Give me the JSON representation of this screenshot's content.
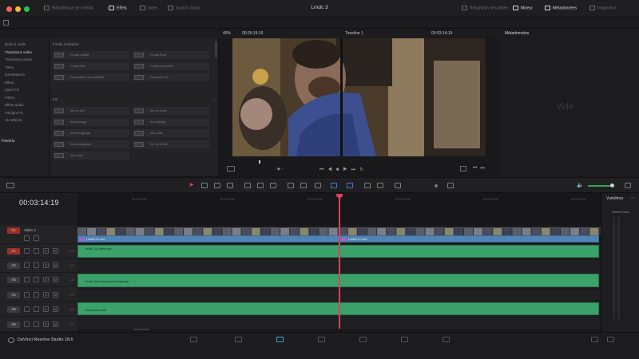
{
  "colors": {
    "bg": "#1a1a1c",
    "audio_clip": "#3aa26a",
    "video_clip": "#4f84b5",
    "playhead": "#e0405a",
    "v1_badge": "#c0392b",
    "a1_badge": "#c0392b"
  },
  "window": {
    "title": "Lmdc 3",
    "tabs": [
      {
        "label": "Bibliothèque de médias",
        "icon": "media-pool-icon"
      },
      {
        "label": "Effets",
        "icon": "effects-icon",
        "active": true
      },
      {
        "label": "Index",
        "icon": "index-icon"
      },
      {
        "label": "Sound Library",
        "icon": "sound-library-icon"
      }
    ],
    "right_tabs": [
      {
        "label": "Répartition des pistes",
        "icon": "track-icon"
      },
      {
        "label": "Mixeur",
        "icon": "mixer-icon"
      },
      {
        "label": "Métadonnées",
        "icon": "metadata-icon",
        "active": true
      },
      {
        "label": "Inspecteur",
        "icon": "inspector-icon"
      }
    ]
  },
  "viewer_bar": {
    "zoom": "40%",
    "source_tc": "00:25:19:16",
    "timeline_name": "Timeline 1",
    "record_tc": "00:03:14:19",
    "panel_title": "Métadonnées"
  },
  "library": {
    "items": [
      {
        "label": "Boîte à outils",
        "sel": false
      },
      {
        "label": "Transitions vidéo",
        "sel": true
      },
      {
        "label": "Transitions audio",
        "sel": false
      },
      {
        "label": "Titres",
        "sel": false
      },
      {
        "label": "Générateurs",
        "sel": false
      },
      {
        "label": "Effets",
        "sel": false
      },
      {
        "label": "Open FX",
        "sel": false
      },
      {
        "label": "Filtres",
        "sel": false
      },
      {
        "label": "Effets audio",
        "sel": false
      },
      {
        "label": "Fairlight FX",
        "sel": false
      },
      {
        "label": "AU Effects",
        "sel": false
      }
    ],
    "favorites": "Favoris"
  },
  "effects": {
    "section1": "Fondu enchaîné",
    "fx1": [
      "Fondu additif",
      "Fondu lissé",
      "Fondu flou",
      "Fondu enchaîné",
      "Dissolution non additive",
      "Dissolve Fun"
    ],
    "section2": "Iris",
    "fx2": [
      "Iris en œil",
      "Iris en croix",
      "Iris losange",
      "Iris triangle",
      "Iris hexagonal",
      "Iris ovale",
      "Iris pentagonal",
      "Iris en étoile",
      "Iris carré"
    ]
  },
  "metadata": {
    "empty": "Vide"
  },
  "timeline": {
    "timecode": "00:03:14:19",
    "ruler": [
      "00:03:10:00",
      "00:03:12:00",
      "00:03:14:00",
      "00:03:16:00",
      "00:03:18:00",
      "00:03:20:00"
    ],
    "tracks": [
      {
        "id": "V1",
        "name": "Vidéo 1",
        "num": "",
        "type": "video"
      },
      {
        "id": "A1",
        "name": "",
        "num": "1.0",
        "type": "audio"
      },
      {
        "id": "A2",
        "name": "",
        "num": "1.0",
        "type": "audio"
      },
      {
        "id": "A3",
        "name": "",
        "num": "1.0",
        "type": "audio"
      },
      {
        "id": "A4",
        "name": "",
        "num": "1.0",
        "type": "audio"
      },
      {
        "id": "A5",
        "name": "",
        "num": "1.0",
        "type": "audio"
      },
      {
        "id": "A6",
        "name": "",
        "num": "1.0",
        "type": "audio"
      }
    ],
    "clips": {
      "v1_a": "Lmdc3-V1.mov",
      "v1_b": "Lmdc3-V1.mov",
      "a1": "Lmdc3_A1-effect.wav",
      "a3": "Lmdc3_A3-environnement-bkg.wav",
      "a5": "Lmdc3-A5-fx.wav"
    },
    "btn_labels": {
      "lock": "🔒",
      "eye": "◉",
      "solo": "S",
      "mute": "M"
    }
  },
  "meters": {
    "title": "Vumètres",
    "label": "Control Room"
  },
  "bottom": {
    "app": "DaVinci Resolve Studio 18.6"
  }
}
